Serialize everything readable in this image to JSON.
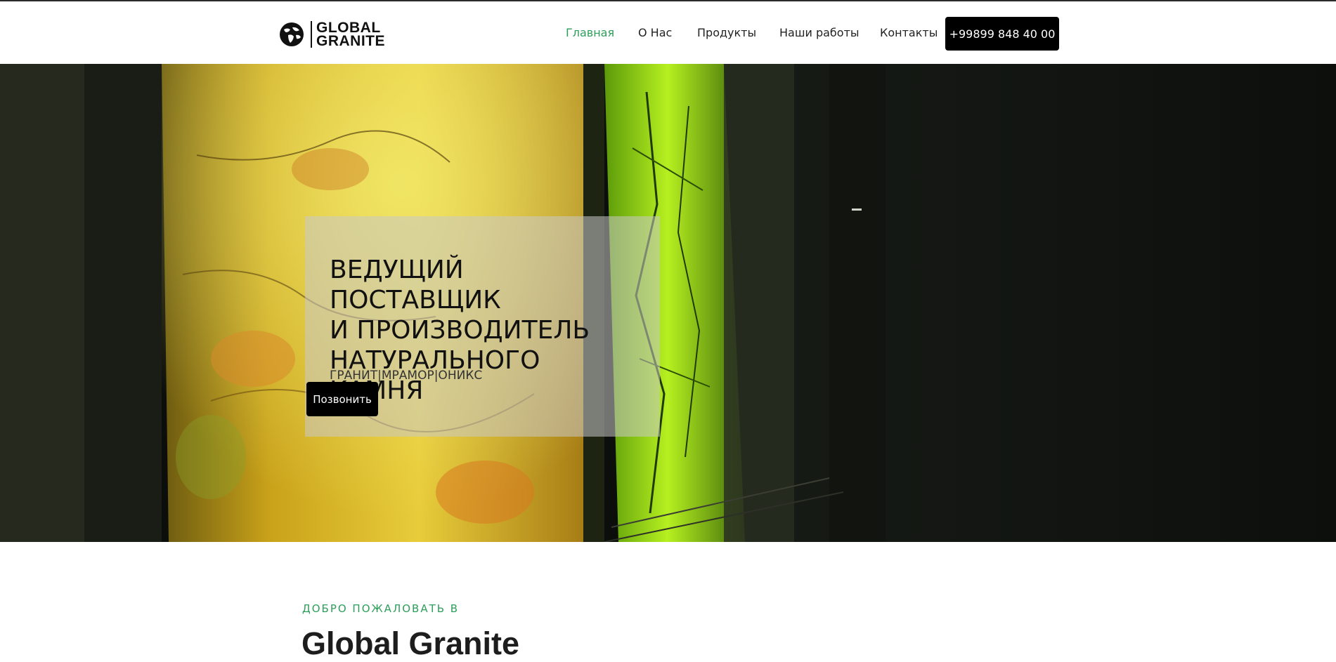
{
  "header": {
    "logo": {
      "line1": "GLOBAL",
      "line2": "GRANITE",
      "icon": "globe-icon"
    },
    "nav": [
      {
        "label": "Главная",
        "active": true
      },
      {
        "label": "О Нас",
        "active": false
      },
      {
        "label": "Продукты",
        "active": false
      },
      {
        "label": "Наши работы",
        "active": false
      },
      {
        "label": "Контакты",
        "active": false
      }
    ],
    "phone": "+99899 848 40 00"
  },
  "hero": {
    "headline": [
      "ВЕДУЩИЙ ПОСТАВЩИК",
      "И ПРОИЗВОДИТЕЛЬ",
      "НАТУРАЛЬНОГО КАМНЯ"
    ],
    "tags": "ГРАНИТ|МРАМОР|ОНИКС",
    "cta": "Позвонить"
  },
  "welcome": {
    "kicker": "ДОБРО ПОЖАЛОВАТЬ В",
    "title": "Global Granite"
  },
  "colors": {
    "accent": "#2e9e5b",
    "button": "#000000",
    "text": "#111111"
  }
}
